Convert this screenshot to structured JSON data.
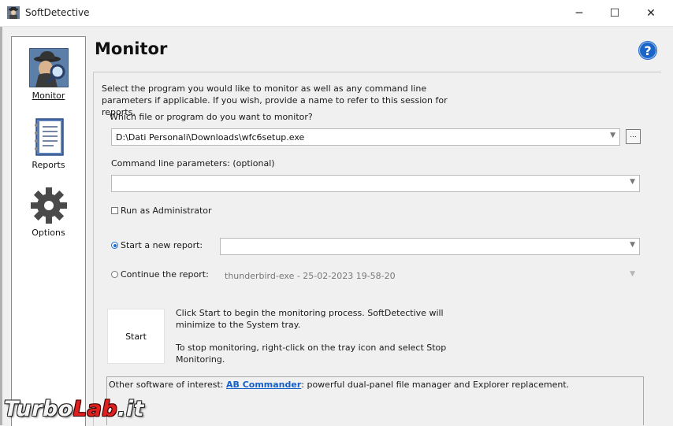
{
  "window": {
    "title": "SoftDetective",
    "app_icon": "spy-detective-icon",
    "controls": {
      "minimize": "─",
      "maximize": "☐",
      "close": "✕"
    }
  },
  "sidebar": {
    "items": [
      {
        "label": "Monitor",
        "icon": "detective-magnifier-icon",
        "selected": true
      },
      {
        "label": "Reports",
        "icon": "notebook-icon",
        "selected": false
      },
      {
        "label": "Options",
        "icon": "gear-icon",
        "selected": false
      }
    ]
  },
  "page": {
    "title": "Monitor",
    "help_icon": "question-circle-icon",
    "help_color": "#1a66c8",
    "intro": "Select the program you would like to monitor as well as any command line parameters if applicable. If you wish, provide a name to refer to this session for reports."
  },
  "program": {
    "label": "Which file or program do you want to monitor?",
    "value": "D:\\Dati Personali\\Downloads\\wfc6setup.exe",
    "browse_label": "..."
  },
  "params": {
    "label": "Command line parameters: (optional)",
    "value": ""
  },
  "run_as_admin": {
    "label": "Run as Administrator",
    "checked": false
  },
  "new_report": {
    "label": "Start a new report:",
    "selected": true,
    "value": ""
  },
  "continue_report": {
    "label": "Continue the report:",
    "selected": false,
    "value": "thunderbird-exe - 25-02-2023 19-58-20"
  },
  "start": {
    "button_label": "Start",
    "info_1": "Click Start to begin the monitoring process. SoftDetective will minimize to the System tray.",
    "info_2": "To stop monitoring, right-click on the tray icon and select Stop Monitoring."
  },
  "footer": {
    "prefix": "Other software of interest: ",
    "link_text": "AB Commander",
    "suffix": ": powerful dual-panel file manager and Explorer replacement.",
    "link_color": "#1560c8"
  },
  "watermark": {
    "part1": "Turbo",
    "part2": "Lab",
    "part3": ".it"
  }
}
